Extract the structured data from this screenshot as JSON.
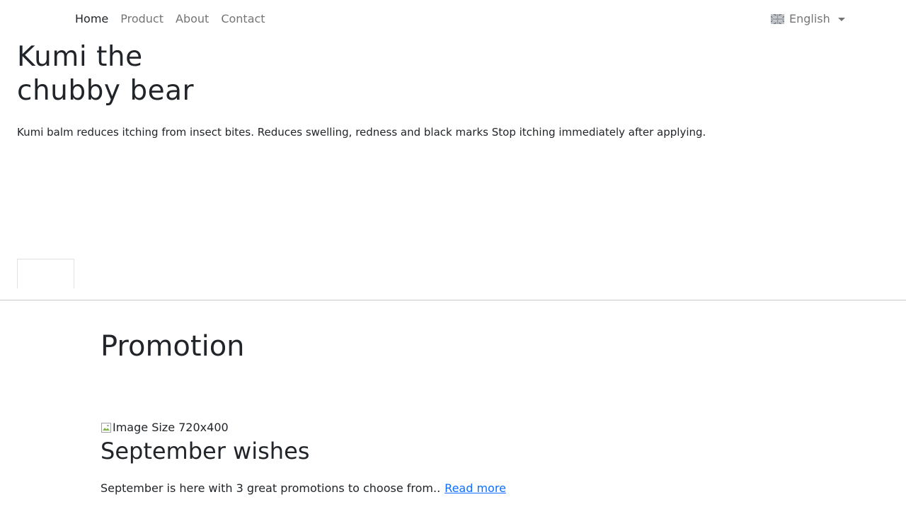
{
  "nav": {
    "links": [
      {
        "label": "Home",
        "active": true
      },
      {
        "label": "Product",
        "active": false
      },
      {
        "label": "About",
        "active": false
      },
      {
        "label": "Contact",
        "active": false
      }
    ],
    "language": {
      "label": "English",
      "icon": "uk-flag-icon"
    }
  },
  "hero": {
    "title": "Kumi the chubby bear",
    "description": "Kumi balm reduces itching from insect bites. Reduces swelling, redness and black marks Stop itching immediately after applying."
  },
  "promotion": {
    "section_title": "Promotion",
    "image_alt": "Image Size 720x400",
    "title": "September wishes",
    "text": "September is here with 3 great promotions to choose from..",
    "read_more": "Read more"
  },
  "colors": {
    "link": "#0d6efd",
    "text": "#212529",
    "nav_muted": "rgba(0,0,0,0.55)"
  }
}
